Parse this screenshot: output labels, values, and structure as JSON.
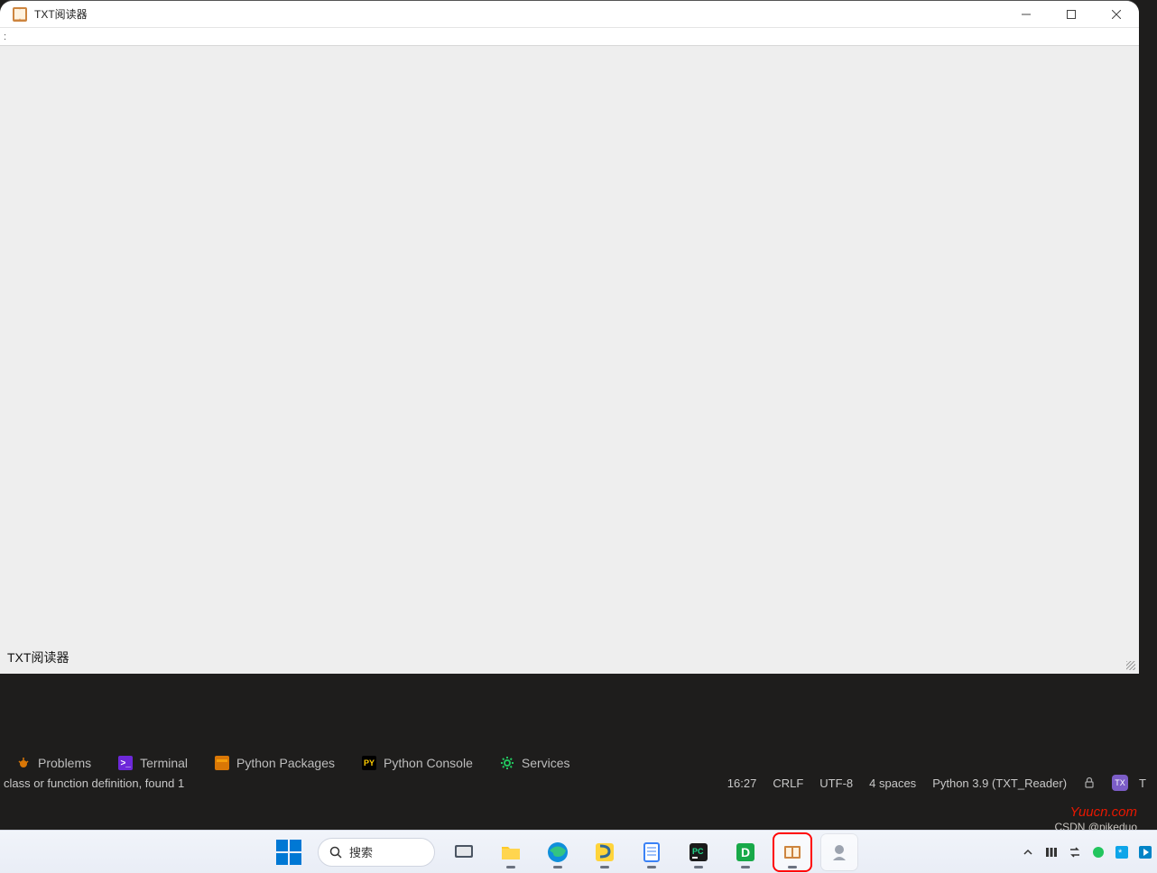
{
  "window": {
    "title": "TXT阅读器",
    "status_text": "TXT阅读器",
    "menu_grip": ":"
  },
  "ide": {
    "tabs": {
      "problems": "Problems",
      "terminal": "Terminal",
      "python_packages": "Python Packages",
      "python_console": "Python Console",
      "services": "Services"
    },
    "status": {
      "left_msg": "class or function definition, found 1",
      "cursor": "16:27",
      "line_sep": "CRLF",
      "encoding": "UTF-8",
      "indent": "4 spaces",
      "interpreter": "Python 3.9 (TXT_Reader)",
      "tx_badge": "TX",
      "tx_partial": "T"
    }
  },
  "watermarks": {
    "site": "Yuucn.com",
    "csdn": "CSDN @pikeduo"
  },
  "taskbar": {
    "search_label": "搜索"
  }
}
